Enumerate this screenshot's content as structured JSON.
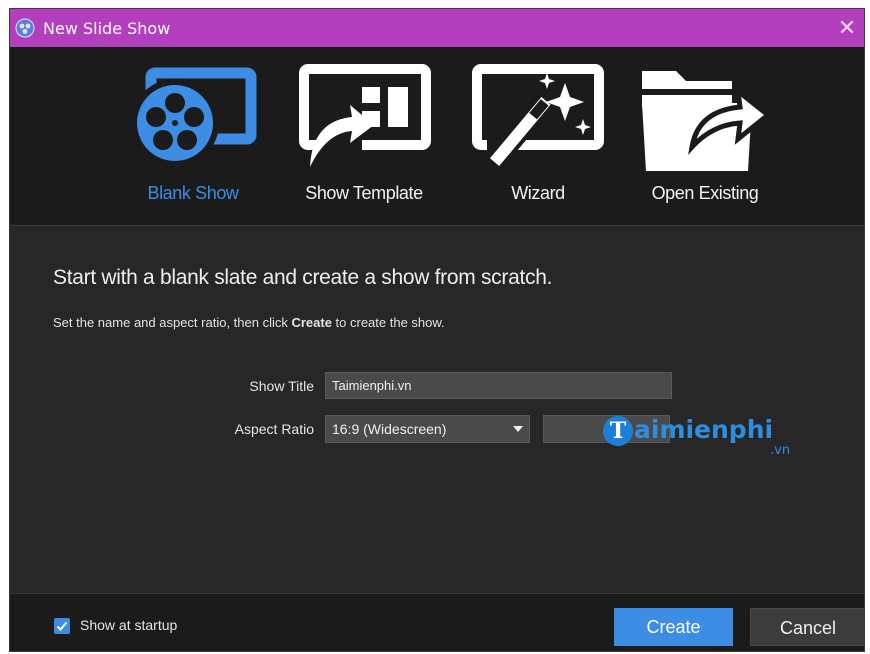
{
  "window": {
    "title": "New Slide Show",
    "close_glyph": "✕",
    "titlebar_color": "#b43fbe",
    "accent_color": "#3d8de5"
  },
  "tabs": [
    {
      "label": "Blank Show",
      "icon": "film-reel-icon",
      "active": true
    },
    {
      "label": "Show Template",
      "icon": "template-icon",
      "active": false
    },
    {
      "label": "Wizard",
      "icon": "magic-wand-icon",
      "active": false
    },
    {
      "label": "Open Existing",
      "icon": "open-folder-icon",
      "active": false
    }
  ],
  "content": {
    "headline": "Start with a blank slate and create a show from scratch.",
    "subline_before": "Set the name and aspect ratio, then click ",
    "subline_bold": "Create",
    "subline_after": " to create the show.",
    "show_title_label": "Show Title",
    "show_title_value": "Taimienphi.vn",
    "aspect_ratio_label": "Aspect Ratio",
    "aspect_ratio_value": "16:9 (Widescreen)"
  },
  "watermark": {
    "initial": "T",
    "text": "aimienphi",
    "suffix": ".vn"
  },
  "footer": {
    "show_at_startup_label": "Show at startup",
    "show_at_startup_checked": true,
    "create_label": "Create",
    "cancel_label": "Cancel"
  }
}
